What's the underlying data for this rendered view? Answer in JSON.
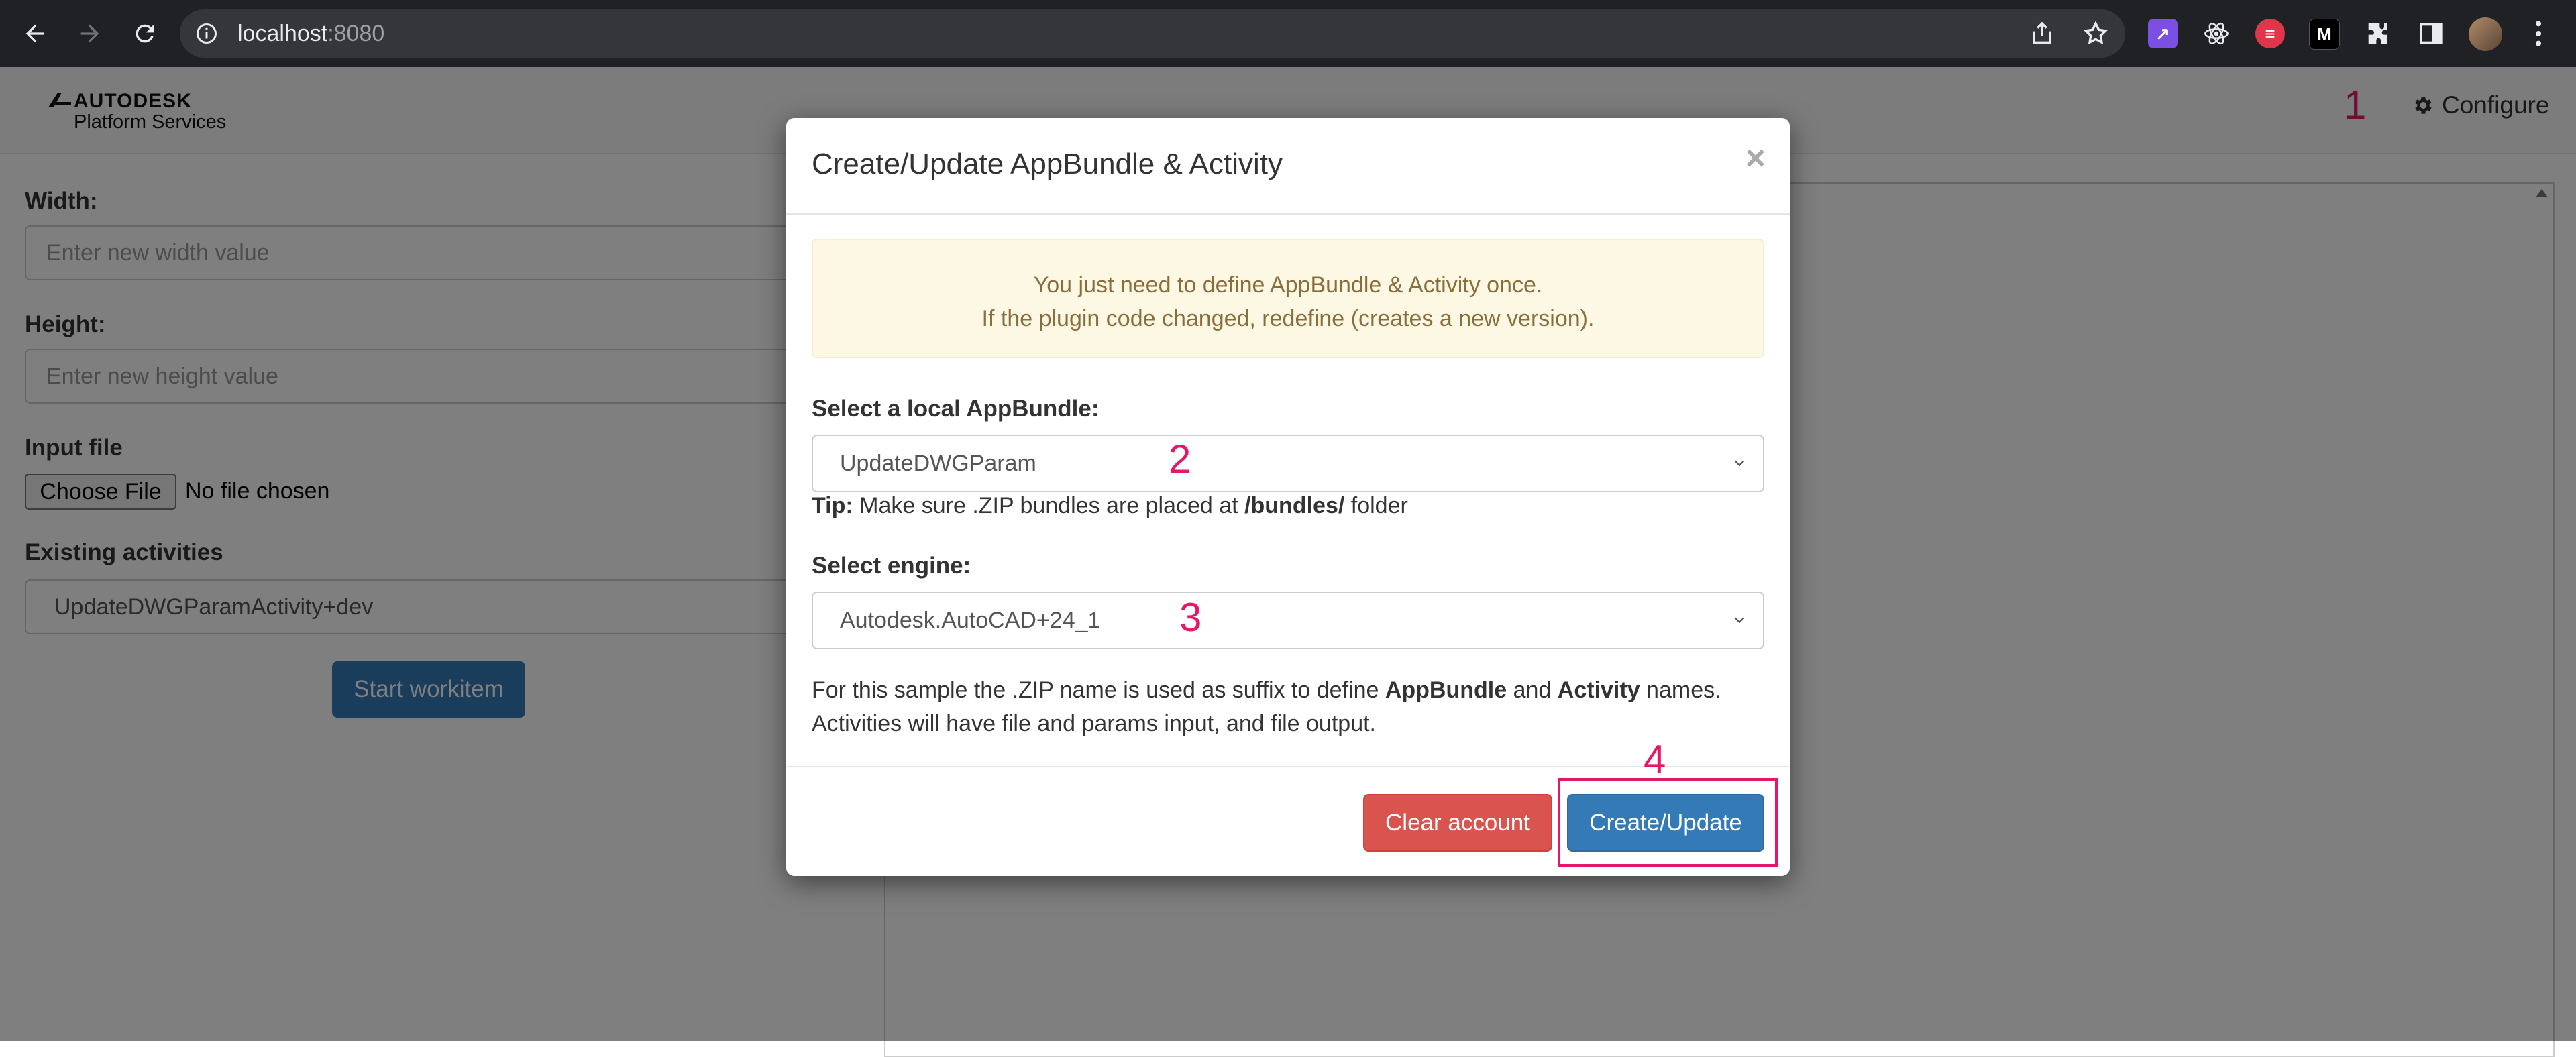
{
  "browser": {
    "url_host": "localhost",
    "url_port": ":8080"
  },
  "header": {
    "logo_line1": "AUTODESK",
    "logo_line2": "Platform Services",
    "configure_label": "Configure"
  },
  "annotations": {
    "step1": "1",
    "step2": "2",
    "step3": "3",
    "step4": "4",
    "color": "#e6176a"
  },
  "form": {
    "width_label": "Width:",
    "width_placeholder": "Enter new width value",
    "height_label": "Height:",
    "height_placeholder": "Enter new height value",
    "input_file_label": "Input file",
    "choose_file_label": "Choose File",
    "no_file_text": "No file chosen",
    "existing_activities_label": "Existing activities",
    "existing_activity_value": "UpdateDWGParamActivity+dev",
    "start_button": "Start workitem"
  },
  "modal": {
    "title": "Create/Update AppBundle & Activity",
    "close": "×",
    "alert_line1": "You just need to define AppBundle & Activity once.",
    "alert_line2": "If the plugin code changed, redefine (creates a new version).",
    "appbundle_label": "Select a local AppBundle:",
    "appbundle_value": "UpdateDWGParam",
    "tip_bold": "Tip:",
    "tip_text1": " Make sure .ZIP bundles are placed at ",
    "tip_path": "/bundles/",
    "tip_text2": " folder",
    "engine_label": "Select engine:",
    "engine_value": "Autodesk.AutoCAD+24_1",
    "desc_part1": "For this sample the .ZIP name is used as suffix to define ",
    "desc_bold1": "AppBundle",
    "desc_part2": " and ",
    "desc_bold2": "Activity",
    "desc_part3": " names.",
    "desc_line2": "Activities will have file and params input, and file output.",
    "clear_button": "Clear account",
    "create_button": "Create/Update"
  },
  "colors": {
    "primary": "#337ab7",
    "danger": "#d9534f",
    "warning_bg": "#fcf8e3",
    "warning_text": "#8a6d3b"
  }
}
